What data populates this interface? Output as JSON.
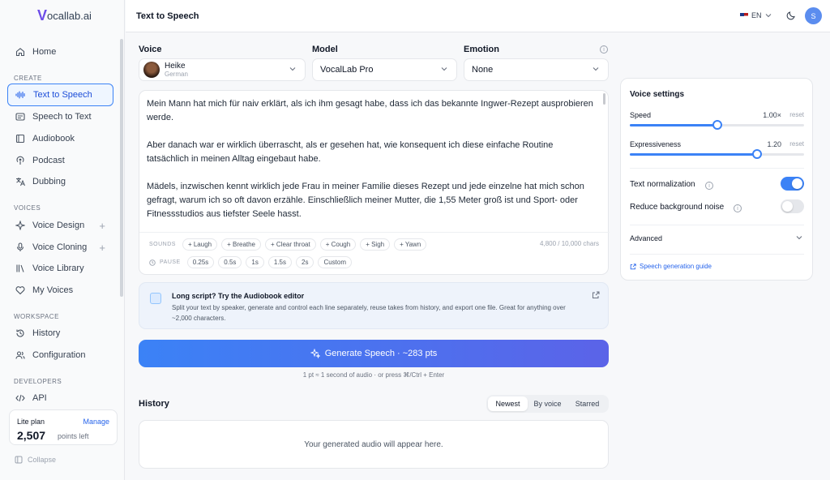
{
  "app": {
    "logo_letter": "V",
    "logo_text": "ocallab.ai"
  },
  "sidebar": {
    "home": "Home",
    "sections": {
      "create": "CREATE",
      "voices": "VOICES",
      "workspace": "WORKSPACE",
      "developers": "DEVELOPERS"
    },
    "items": [
      {
        "label": "Text to Speech",
        "icon": "waveform-icon"
      },
      {
        "label": "Speech to Text",
        "icon": "transcript-icon"
      },
      {
        "label": "Audiobook",
        "icon": "book-icon"
      },
      {
        "label": "Podcast",
        "icon": "podcast-icon"
      },
      {
        "label": "Dubbing",
        "icon": "translate-icon"
      },
      {
        "label": "Voice Design",
        "icon": "sparkle-icon"
      },
      {
        "label": "Voice Cloning",
        "icon": "microphone-icon"
      },
      {
        "label": "Voice Library",
        "icon": "library-icon"
      },
      {
        "label": "My Voices",
        "icon": "heart-icon"
      },
      {
        "label": "History",
        "icon": "history-icon"
      },
      {
        "label": "Configuration",
        "icon": "users-icon"
      },
      {
        "label": "API",
        "icon": "code-icon"
      }
    ],
    "plan": {
      "name": "Lite plan",
      "manage": "Manage",
      "points": "2,507",
      "points_label": "points left"
    },
    "collapse": "Collapse"
  },
  "header": {
    "title": "Text to Speech",
    "language": "EN",
    "avatar": "S"
  },
  "controls": {
    "voice_label": "Voice",
    "voice_name": "Heike",
    "voice_lang": "German",
    "model_label": "Model",
    "model_value": "VocalLab Pro",
    "emotion_label": "Emotion",
    "emotion_value": "None"
  },
  "editor": {
    "paragraphs": [
      "Mein Mann hat mich für naiv erklärt, als ich ihm gesagt habe, dass ich das bekannte Ingwer-Rezept ausprobieren werde.",
      "Aber danach war er wirklich überrascht, als er gesehen hat, wie konsequent ich diese einfache Routine tatsächlich in meinen Alltag eingebaut habe.",
      "Mädels, inzwischen kennt wirklich jede Frau in meiner Familie dieses Rezept und jede einzelne hat mich schon gefragt, warum ich so oft davon erzähle. Einschließlich meiner Mutter, die 1,55 Meter groß ist und Sport- oder Fitnessstudios aus tiefster Seele hasst."
    ],
    "sounds_label": "SOUNDS",
    "sounds": [
      "+ Laugh",
      "+ Breathe",
      "+ Clear throat",
      "+ Cough",
      "+ Sigh",
      "+ Yawn"
    ],
    "pause_label": "PAUSE",
    "pauses": [
      "0.25s",
      "0.5s",
      "1s",
      "1.5s",
      "2s",
      "Custom"
    ],
    "char_count": "4,800 / 10,000 chars"
  },
  "banner": {
    "title": "Long script? Try the Audiobook editor",
    "text": "Split your text by speaker, generate and control each line separately, reuse takes from history, and export one file. Great for anything over ~2,000 characters."
  },
  "generate": {
    "label": "Generate Speech · ~283 pts",
    "hint": "1 pt ≈ 1 second of audio · or press ⌘/Ctrl + Enter"
  },
  "history": {
    "title": "History",
    "tabs": [
      "Newest",
      "By voice",
      "Starred"
    ],
    "empty": "Your generated audio will appear here."
  },
  "settings": {
    "title": "Voice settings",
    "speed": {
      "label": "Speed",
      "value": "1.00×",
      "reset": "reset",
      "level": 0.5
    },
    "expressiveness": {
      "label": "Expressiveness",
      "value": "1.20",
      "reset": "reset",
      "level": 0.73
    },
    "text_normalization": {
      "label": "Text normalization",
      "on": true
    },
    "reduce_noise": {
      "label": "Reduce background noise",
      "on": false
    },
    "advanced": "Advanced",
    "guide": "Speech generation guide"
  }
}
